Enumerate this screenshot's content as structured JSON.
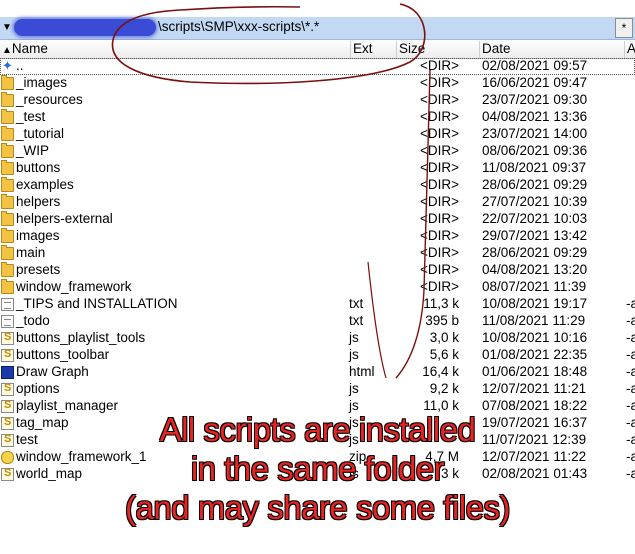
{
  "path_bar": {
    "path_text": "\\scripts\\SMP\\xxx-scripts\\*.*",
    "star_button": "*"
  },
  "columns": {
    "name": "Name",
    "ext": "Ext",
    "size": "Size",
    "date": "Date",
    "attr": "A"
  },
  "rows": [
    {
      "name": "..",
      "ext": "",
      "size": "<DIR>",
      "date": "02/08/2021 09:57",
      "attr": "",
      "icon": "up-icon"
    },
    {
      "name": "_images",
      "ext": "",
      "size": "<DIR>",
      "date": "16/06/2021 09:47",
      "attr": "",
      "icon": "folder-icon"
    },
    {
      "name": "_resources",
      "ext": "",
      "size": "<DIR>",
      "date": "23/07/2021 09:30",
      "attr": "",
      "icon": "folder-icon"
    },
    {
      "name": "_test",
      "ext": "",
      "size": "<DIR>",
      "date": "04/08/2021 13:36",
      "attr": "",
      "icon": "folder-icon"
    },
    {
      "name": "_tutorial",
      "ext": "",
      "size": "<DIR>",
      "date": "23/07/2021 14:00",
      "attr": "",
      "icon": "folder-icon"
    },
    {
      "name": "_WIP",
      "ext": "",
      "size": "<DIR>",
      "date": "08/06/2021 09:36",
      "attr": "",
      "icon": "folder-icon"
    },
    {
      "name": "buttons",
      "ext": "",
      "size": "<DIR>",
      "date": "11/08/2021 09:37",
      "attr": "",
      "icon": "folder-icon"
    },
    {
      "name": "examples",
      "ext": "",
      "size": "<DIR>",
      "date": "28/06/2021 09:29",
      "attr": "",
      "icon": "folder-icon"
    },
    {
      "name": "helpers",
      "ext": "",
      "size": "<DIR>",
      "date": "27/07/2021 10:39",
      "attr": "",
      "icon": "folder-icon"
    },
    {
      "name": "helpers-external",
      "ext": "",
      "size": "<DIR>",
      "date": "22/07/2021 10:03",
      "attr": "",
      "icon": "folder-icon"
    },
    {
      "name": "images",
      "ext": "",
      "size": "<DIR>",
      "date": "29/07/2021 13:42",
      "attr": "",
      "icon": "folder-icon"
    },
    {
      "name": "main",
      "ext": "",
      "size": "<DIR>",
      "date": "28/06/2021 09:29",
      "attr": "",
      "icon": "folder-icon"
    },
    {
      "name": "presets",
      "ext": "",
      "size": "<DIR>",
      "date": "04/08/2021 13:20",
      "attr": "",
      "icon": "folder-icon"
    },
    {
      "name": "window_framework",
      "ext": "",
      "size": "<DIR>",
      "date": "08/07/2021 11:39",
      "attr": "",
      "icon": "folder-icon"
    },
    {
      "name": "_TIPS and INSTALLATION",
      "ext": "txt",
      "size": "11,3 k",
      "date": "10/08/2021 19:17",
      "attr": "-a",
      "icon": "text-file-icon"
    },
    {
      "name": "_todo",
      "ext": "txt",
      "size": "395 b",
      "date": "11/08/2021 11:29",
      "attr": "-a",
      "icon": "text-file-icon"
    },
    {
      "name": "buttons_playlist_tools",
      "ext": "js",
      "size": "3,0 k",
      "date": "10/08/2021 10:16",
      "attr": "-a",
      "icon": "js-file-icon"
    },
    {
      "name": "buttons_toolbar",
      "ext": "js",
      "size": "5,6 k",
      "date": "01/08/2021 22:35",
      "attr": "-a",
      "icon": "js-file-icon"
    },
    {
      "name": "Draw Graph",
      "ext": "html",
      "size": "16,4 k",
      "date": "01/06/2021 18:48",
      "attr": "-a",
      "icon": "html-file-icon"
    },
    {
      "name": "options",
      "ext": "js",
      "size": "9,2 k",
      "date": "12/07/2021 11:21",
      "attr": "-a",
      "icon": "js-file-icon"
    },
    {
      "name": "playlist_manager",
      "ext": "js",
      "size": "11,0 k",
      "date": "07/08/2021 18:22",
      "attr": "-a",
      "icon": "js-file-icon"
    },
    {
      "name": "tag_map",
      "ext": "js",
      "size": "",
      "date": "19/07/2021 16:37",
      "attr": "-a",
      "icon": "js-file-icon"
    },
    {
      "name": "test",
      "ext": "js",
      "size": "",
      "date": "11/07/2021 12:39",
      "attr": "-a",
      "icon": "js-file-icon"
    },
    {
      "name": "window_framework_1",
      "ext": "zip",
      "size": "4,7 M",
      "date": "12/07/2021 11:22",
      "attr": "-a",
      "icon": "zip-file-icon"
    },
    {
      "name": "world_map",
      "ext": "js",
      "size": "3 k",
      "date": "02/08/2021 01:43",
      "attr": "-a",
      "icon": "js-file-icon"
    }
  ],
  "annotation": {
    "line1": "All scripts are installed",
    "line2": "in the same folder",
    "line3": "(and may share some files)",
    "color": "#e82323"
  },
  "colors": {
    "path_bar_bg": "#c3d9f3",
    "redaction": "#3a4bd6",
    "folder": "#f3c443",
    "scribble": "#7a1010"
  }
}
